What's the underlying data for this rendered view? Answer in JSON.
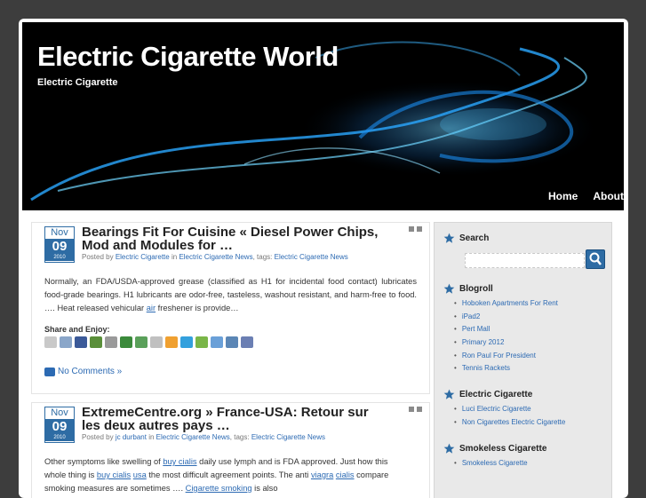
{
  "header": {
    "title": "Electric Cigarette World",
    "description": "Electric Cigarette",
    "nav": [
      "Home",
      "About"
    ]
  },
  "posts": [
    {
      "month": "Nov",
      "day": "09",
      "year": "2010",
      "title": "Bearings Fit For Cuisine « Diesel Power Chips, Mod and Modules for …",
      "meta_posted_by": "Posted by",
      "meta_author": "Electric Cigarette",
      "meta_in": "in",
      "meta_category": "Electric Cigarette News",
      "meta_tags": ", tags:",
      "meta_tag": "Electric Cigarette News",
      "body_pre": "Normally, an FDA/USDA-approved grease (classified as H1 for incidental food contact) lubricates food-grade bearings. H1 lubricants are odor-free, tasteless, washout resistant, and harm-free to food. …. Heat released vehicular ",
      "body_link": "air",
      "body_post": " freshener is provide…",
      "share_heading": "Share and Enjoy:",
      "comments": "No Comments »"
    },
    {
      "month": "Nov",
      "day": "09",
      "year": "2010",
      "title": "ExtremeCentre.org » France-USA: Retour sur les deux autres pays …",
      "meta_posted_by": "Posted by",
      "meta_author": "jc durbant",
      "meta_in": "in",
      "meta_category": "Electric Cigarette News",
      "meta_tags": ", tags:",
      "meta_tag": "Electric Cigarette News",
      "line1_a": "Other symptoms like swelling of ",
      "line1_link": "buy cialis",
      "line1_b": " daily use lymph and is FDA approved. Just how this",
      "line2_a": "whole thing is ",
      "line2_link1": "buy cialis",
      "line2_link2": "usa",
      "line2_b": " the most difficult agreement points. The anti ",
      "line2_link3": "viagra",
      "line2_link4": "cialis",
      "line2_c": " compare",
      "line3_a": "smoking measures are sometimes …. ",
      "line3_link": "Cigarette smoking",
      "line3_b": " is also"
    }
  ],
  "sidebar": {
    "search_title": "Search",
    "blogroll_title": "Blogroll",
    "blogroll": [
      "Hoboken Apartments For Rent",
      "iPad2",
      "Pert Mall",
      "Primary 2012",
      "Ron Paul For President",
      "Tennis Rackets"
    ],
    "ec_title": "Electric Cigarette",
    "ec_links": [
      "Luci Electric Cigarette",
      "Non Cigarettes Electric Cigarette"
    ],
    "sc_title": "Smokeless Cigarette",
    "sc_links": [
      "Smokeless Cigarette"
    ]
  },
  "colors": {
    "page_bg": "#3d3d3d",
    "accent": "#2e6ca4",
    "link": "#2c6ab3",
    "header_glow": "#2aa8ff"
  },
  "share_icon_colors": [
    "#c9c9c9",
    "#8aa6c9",
    "#3b5998",
    "#5a8f3a",
    "#9a9a9a",
    "#3b8a3b",
    "#5aa05a",
    "#c0c0c0",
    "#f0a030",
    "#33a0dd",
    "#7ab648",
    "#6aa0d8",
    "#5b86b5",
    "#6b7fb3"
  ]
}
